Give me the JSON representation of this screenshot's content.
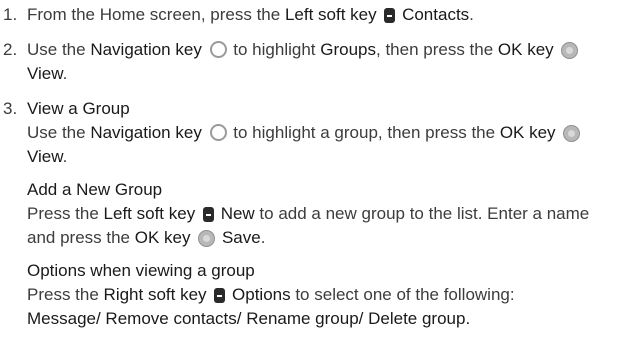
{
  "steps": [
    {
      "number": "1.",
      "text1": "From the Home screen, press the ",
      "key1": "Left soft key",
      "icon1": "left-softkey-icon",
      "label1": "Contacts",
      "text_end": "."
    },
    {
      "number": "2.",
      "text1": "Use the ",
      "key1": "Navigation key",
      "icon1": "navigation-key-icon",
      "text2": " to highlight ",
      "target": "Groups",
      "text3": ", then press the ",
      "key2": "OK key",
      "icon2": "ok-key-icon",
      "label2": "View",
      "text_end": "."
    },
    {
      "number": "3.",
      "title": "View a Group",
      "text1": "Use the ",
      "key1": "Navigation key",
      "icon1": "navigation-key-icon",
      "text2": " to highlight a group, then press the ",
      "key2": "OK key",
      "icon2": "ok-key-icon",
      "label2": "View",
      "text_end": "."
    }
  ],
  "add_group": {
    "title": "Add a New Group",
    "text1": "Press the ",
    "key1": "Left soft key",
    "icon1": "left-softkey-icon",
    "label1": "New",
    "text2": " to add a new group to the list. Enter a name and press the ",
    "key2": "OK key",
    "icon2": "ok-key-icon",
    "label2": "Save",
    "text_end": "."
  },
  "options_group": {
    "title": "Options when viewing a group",
    "text1": "Press the ",
    "key1": "Right soft key",
    "icon1": "right-softkey-icon",
    "label1": "Options",
    "text2": " to select one of the following:",
    "options_list": "Message/ Remove contacts/ Rename group/ Delete group."
  }
}
